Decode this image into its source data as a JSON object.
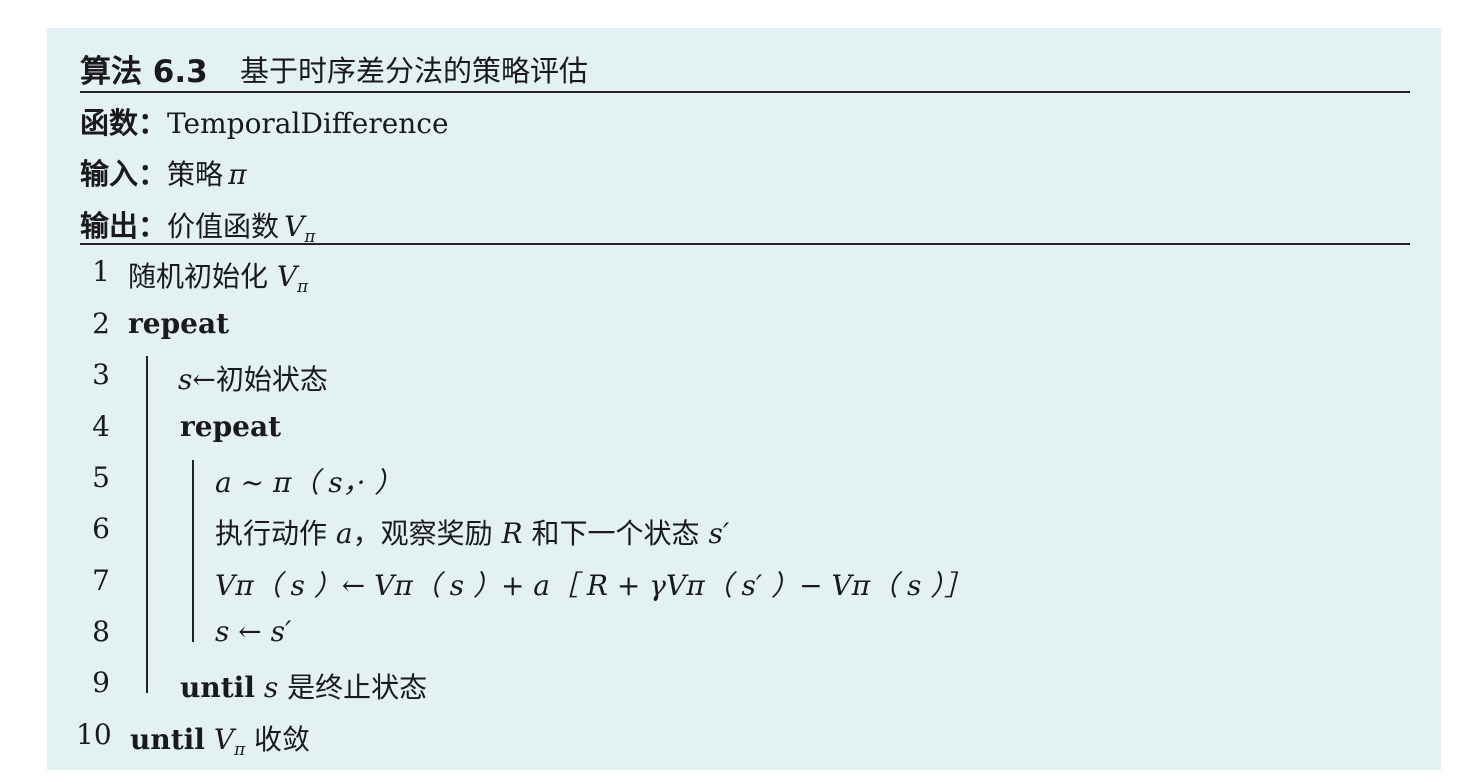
{
  "algorithm": {
    "label": "算法 6.3",
    "title": "基于时序差分法的策略评估"
  },
  "header": {
    "function_label": "函数：",
    "function_value": "TemporalDifference",
    "input_label": "输入：",
    "input_text": "策略",
    "input_symbol": "π",
    "output_label": "输出：",
    "output_text": "价值函数",
    "output_symbol": "V",
    "output_sub": "π"
  },
  "lines": [
    {
      "num": "1",
      "text": "随机初始化",
      "sym": "V",
      "sub": "π"
    },
    {
      "num": "2",
      "kw": "repeat"
    },
    {
      "num": "3",
      "sym": "s",
      "arrow": "←",
      "text": "初始状态"
    },
    {
      "num": "4",
      "kw": "repeat"
    },
    {
      "num": "5",
      "expr": "a ~ π（ s，· ）"
    },
    {
      "num": "6",
      "text1": "执行动作",
      "sym1": "a",
      "text2": "，观察奖励",
      "sym2": "R",
      "text3": "和下一个状态",
      "sym3": "s′"
    },
    {
      "num": "7",
      "expr": "Vπ（ s ）← Vπ（ s ）+ a［ R + γVπ（ s′ ）− Vπ（ s ）］"
    },
    {
      "num": "8",
      "expr": "s ← s′"
    },
    {
      "num": "9",
      "kw": "until",
      "sym": "s",
      "text": "是终止状态"
    },
    {
      "num": "10",
      "kw": "until",
      "sym": "V",
      "sub": "π",
      "text": "收敛"
    }
  ]
}
